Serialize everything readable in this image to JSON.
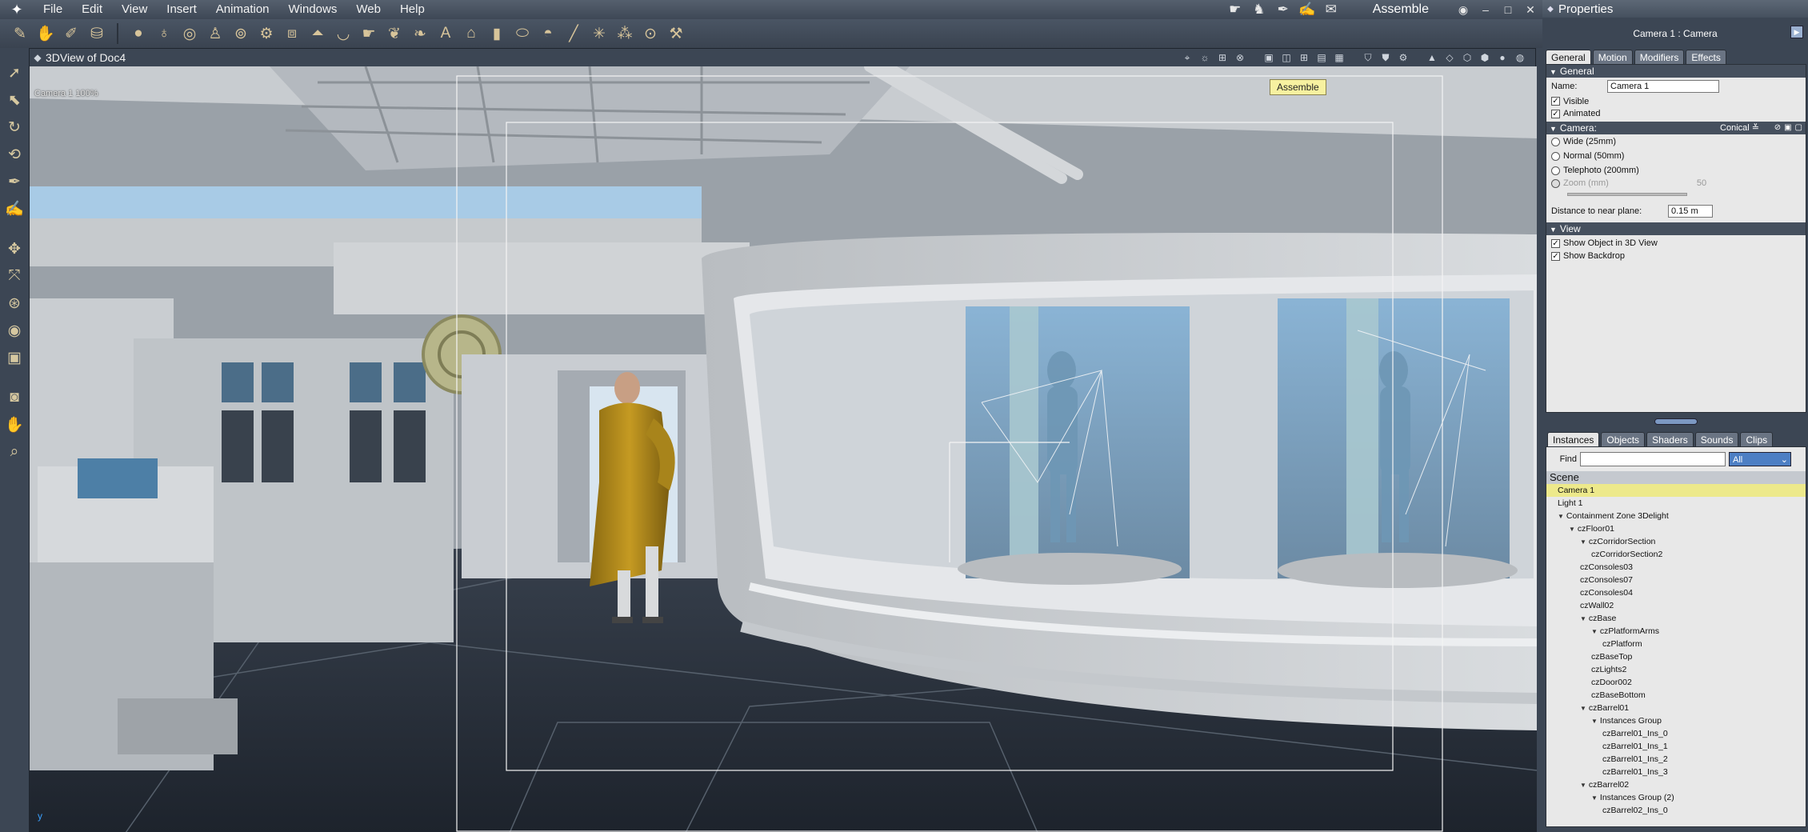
{
  "menubar": {
    "menus": [
      "File",
      "Edit",
      "View",
      "Insert",
      "Animation",
      "Windows",
      "Web",
      "Help"
    ],
    "room_title": "Assemble",
    "room_icons": [
      "hand-icon",
      "pose-icon",
      "brush-icon",
      "paint-icon",
      "script-icon"
    ]
  },
  "toolbar": {
    "tools": [
      "pointer-tool-icon",
      "hand-tool-icon",
      "pencil-tool-icon",
      "camera-tool-icon",
      "sphere-icon",
      "pen-icon",
      "ring-icon",
      "figure-icon",
      "torus-icon",
      "gear-icon",
      "box-icon",
      "cone-icon",
      "bowl-icon",
      "hand-icon",
      "plant-icon",
      "leaf-icon",
      "text-icon",
      "house-icon",
      "cylinder-icon",
      "drum-icon",
      "shell-icon",
      "stick-icon",
      "spider-icon",
      "molecule-icon",
      "target-icon",
      "wrench-icon"
    ]
  },
  "lefttools": [
    "arrow-tool-icon",
    "select-tool-icon",
    "rotate-tool-icon",
    "twist-tool-icon",
    "brush-tool-icon",
    "paint-tool-icon",
    "move-tool-icon",
    "scale-tool-icon",
    "orbit-tool-icon",
    "trackball-tool-icon",
    "box-tool-icon",
    "camera-move-icon",
    "pan-hand-icon",
    "zoom-icon"
  ],
  "viewport": {
    "title": "3DView of Doc4",
    "camera_label": "Camera 1 100%",
    "tooltip": "Assemble",
    "axis_label": "y"
  },
  "properties": {
    "title": "Properties",
    "header": "Camera 1 : Camera",
    "tabs": [
      "General",
      "Motion",
      "Modifiers",
      "Effects"
    ],
    "general": {
      "section": "General",
      "name_label": "Name:",
      "name_value": "Camera 1",
      "visible_label": "Visible",
      "visible_checked": true,
      "animated_label": "Animated",
      "animated_checked": true
    },
    "camera": {
      "section": "Camera:",
      "projection": "Conical",
      "lenses": [
        "Wide (25mm)",
        "Normal (50mm)",
        "Telephoto (200mm)"
      ],
      "zoom_label": "Zoom (mm)",
      "zoom_value": "50",
      "near_plane_label": "Distance to near plane:",
      "near_plane_value": "0.15 m"
    },
    "view": {
      "section": "View",
      "show_object_label": "Show Object in 3D View",
      "show_backdrop_label": "Show Backdrop"
    }
  },
  "instances": {
    "tabs": [
      "Instances",
      "Objects",
      "Shaders",
      "Sounds",
      "Clips"
    ],
    "find_label": "Find",
    "find_value": "",
    "filter_value": "All",
    "tree_root": "Scene",
    "nodes": [
      {
        "label": "Camera 1",
        "depth": 0,
        "toggle": "",
        "selected": true
      },
      {
        "label": "Light 1",
        "depth": 0,
        "toggle": "",
        "selected": false
      },
      {
        "label": "Containment Zone 3Delight",
        "depth": 0,
        "toggle": "▼",
        "selected": false
      },
      {
        "label": "czFloor01",
        "depth": 1,
        "toggle": "▼",
        "selected": false
      },
      {
        "label": "czCorridorSection",
        "depth": 2,
        "toggle": "▼",
        "selected": false
      },
      {
        "label": "czCorridorSection2",
        "depth": 3,
        "toggle": "",
        "selected": false
      },
      {
        "label": "czConsoles03",
        "depth": 2,
        "toggle": "",
        "selected": false
      },
      {
        "label": "czConsoles07",
        "depth": 2,
        "toggle": "",
        "selected": false
      },
      {
        "label": "czConsoles04",
        "depth": 2,
        "toggle": "",
        "selected": false
      },
      {
        "label": "czWall02",
        "depth": 2,
        "toggle": "",
        "selected": false
      },
      {
        "label": "czBase",
        "depth": 2,
        "toggle": "▼",
        "selected": false
      },
      {
        "label": "czPlatformArms",
        "depth": 3,
        "toggle": "▼",
        "selected": false
      },
      {
        "label": "czPlatform",
        "depth": 4,
        "toggle": "",
        "selected": false
      },
      {
        "label": "czBaseTop",
        "depth": 3,
        "toggle": "",
        "selected": false
      },
      {
        "label": "czLights2",
        "depth": 3,
        "toggle": "",
        "selected": false
      },
      {
        "label": "czDoor002",
        "depth": 3,
        "toggle": "",
        "selected": false
      },
      {
        "label": "czBaseBottom",
        "depth": 3,
        "toggle": "",
        "selected": false
      },
      {
        "label": "czBarrel01",
        "depth": 2,
        "toggle": "▼",
        "selected": false
      },
      {
        "label": "Instances Group",
        "depth": 3,
        "toggle": "▼",
        "selected": false
      },
      {
        "label": "czBarrel01_Ins_0",
        "depth": 4,
        "toggle": "",
        "selected": false
      },
      {
        "label": "czBarrel01_Ins_1",
        "depth": 4,
        "toggle": "",
        "selected": false
      },
      {
        "label": "czBarrel01_Ins_2",
        "depth": 4,
        "toggle": "",
        "selected": false
      },
      {
        "label": "czBarrel01_Ins_3",
        "depth": 4,
        "toggle": "",
        "selected": false
      },
      {
        "label": "czBarrel02",
        "depth": 2,
        "toggle": "▼",
        "selected": false
      },
      {
        "label": "Instances Group (2)",
        "depth": 3,
        "toggle": "▼",
        "selected": false
      },
      {
        "label": "czBarrel02_Ins_0",
        "depth": 4,
        "toggle": "",
        "selected": false
      }
    ]
  },
  "colors": {
    "chrome": "#3c4654",
    "selection": "#ede98b",
    "tooltip": "#f7f1a0",
    "figure_robe": "#b8901f",
    "glass": "#7fb0d6"
  }
}
